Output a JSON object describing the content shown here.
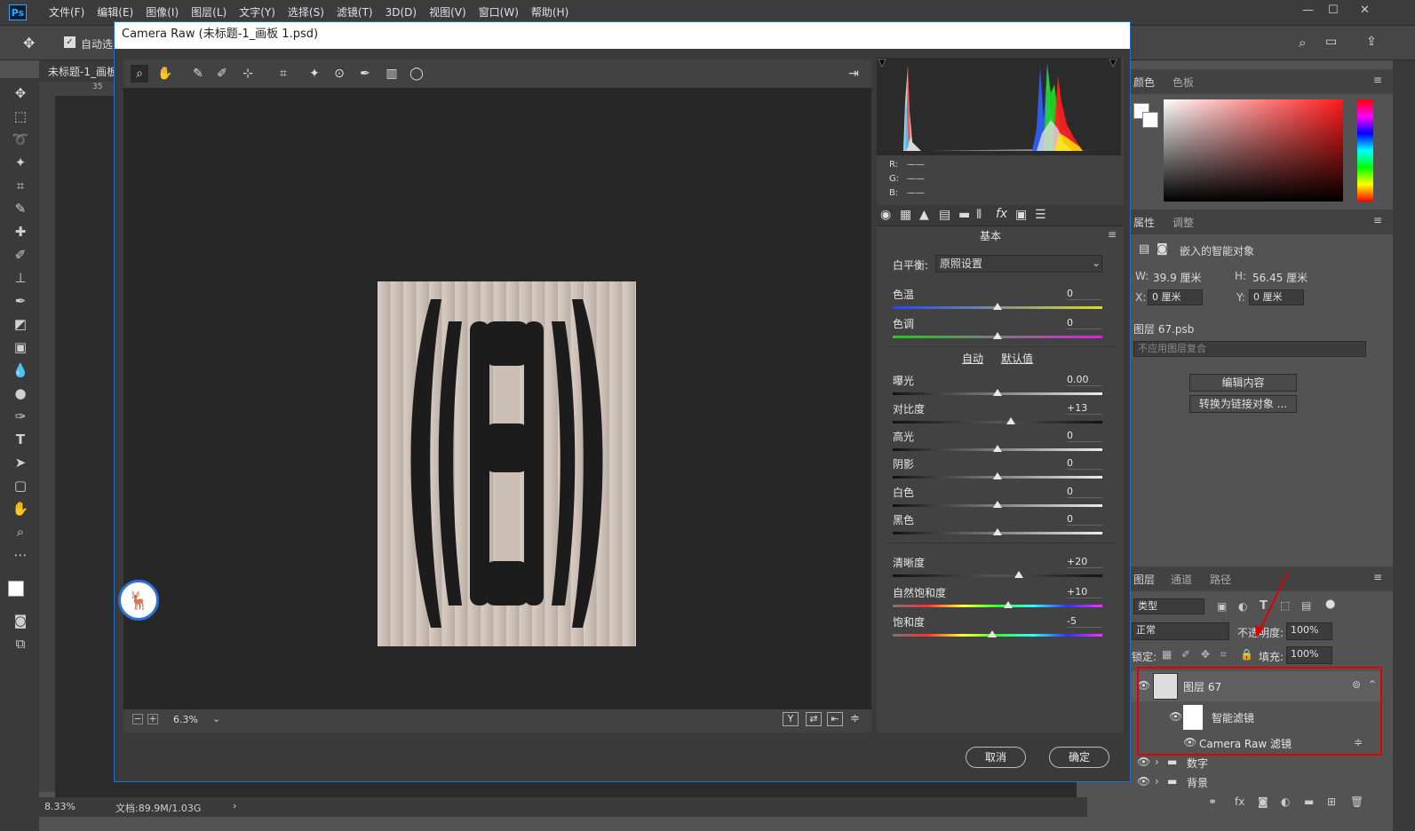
{
  "app": {
    "logo": "Ps"
  },
  "menubar": {
    "items": [
      "文件(F)",
      "编辑(E)",
      "图像(I)",
      "图层(L)",
      "文字(Y)",
      "选择(S)",
      "滤镜(T)",
      "3D(D)",
      "视图(V)",
      "窗口(W)",
      "帮助(H)"
    ]
  },
  "window_controls": {
    "minimize": "—",
    "maximize": "☐",
    "close": "✕"
  },
  "options_bar": {
    "auto_select_label": "自动选"
  },
  "document": {
    "tab_title": "未标题-1_画板",
    "ruler_mark": "35"
  },
  "status": {
    "zoom": "8.33%",
    "doc_info": "文档:89.9M/1.03G",
    "arrow": "›"
  },
  "panels": {
    "color_tabs": [
      "颜色",
      "色板"
    ],
    "props_tabs": [
      "属性",
      "调整"
    ],
    "props": {
      "type": "嵌入的智能对象",
      "w_label": "W:",
      "w_value": "39.9 厘米",
      "h_label": "H:",
      "h_value": "56.45 厘米",
      "x_label": "X:",
      "x_value": "0 厘米",
      "y_label": "Y:",
      "y_value": "0 厘米",
      "file": "图层 67.psb",
      "comp": "不应用图层复合",
      "edit_btn": "编辑内容",
      "convert_btn": "转换为链接对象 ..."
    },
    "layers_tabs": [
      "图层",
      "通道",
      "路径"
    ],
    "layers": {
      "filter_kind": "类型",
      "blend_mode": "正常",
      "opacity_label": "不透明度:",
      "opacity_value": "100%",
      "lock_label": "锁定:",
      "fill_label": "填充:",
      "fill_value": "100%",
      "rows": [
        {
          "name": "图层 67"
        },
        {
          "name": "智能滤镜"
        },
        {
          "name": "Camera Raw 滤镜"
        },
        {
          "name": "数字"
        },
        {
          "name": "背景"
        }
      ]
    }
  },
  "camera_raw": {
    "title": "Camera Raw (未标题-1_画板 1.psd)",
    "zoom": "6.3%",
    "rgb": {
      "r": "R:",
      "g": "G:",
      "b": "B:",
      "r_val": "——",
      "g_val": "——",
      "b_val": "——"
    },
    "panel_title": "基本",
    "wb_label": "白平衡:",
    "wb_value": "原照设置",
    "auto": "自动",
    "default": "默认值",
    "sliders": [
      {
        "label": "色温",
        "value": "0",
        "pos": 0.5
      },
      {
        "label": "色调",
        "value": "0",
        "pos": 0.5
      },
      {
        "label": "曝光",
        "value": "0.00",
        "pos": 0.5
      },
      {
        "label": "对比度",
        "value": "+13",
        "pos": 0.565
      },
      {
        "label": "高光",
        "value": "0",
        "pos": 0.5
      },
      {
        "label": "阴影",
        "value": "0",
        "pos": 0.5
      },
      {
        "label": "白色",
        "value": "0",
        "pos": 0.5
      },
      {
        "label": "黑色",
        "value": "0",
        "pos": 0.5
      },
      {
        "label": "清晰度",
        "value": "+20",
        "pos": 0.6
      },
      {
        "label": "自然饱和度",
        "value": "+10",
        "pos": 0.55
      },
      {
        "label": "饱和度",
        "value": "-5",
        "pos": 0.475
      }
    ],
    "cancel": "取消",
    "ok": "确定"
  }
}
